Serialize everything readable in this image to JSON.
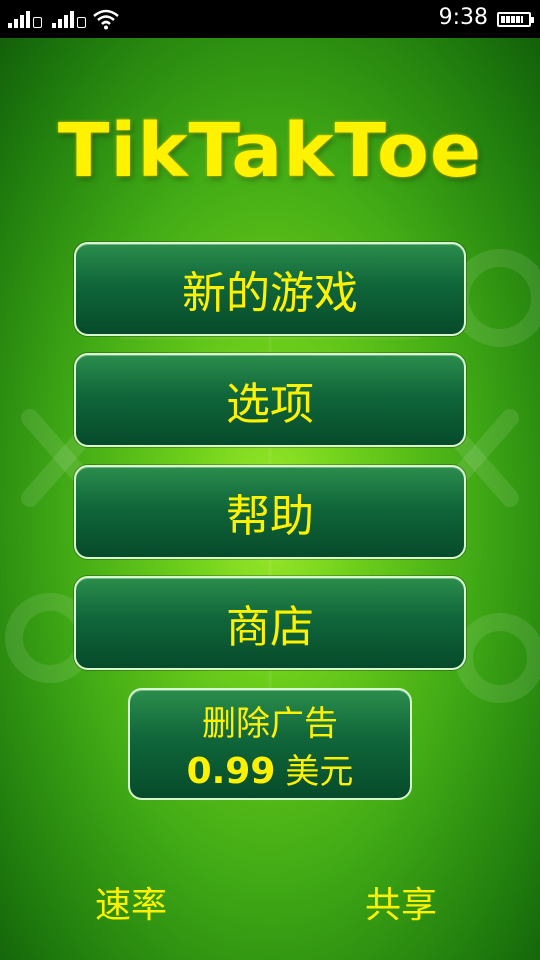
{
  "status_bar": {
    "time": "9:38",
    "sim1_label": "1",
    "sim2_label": "2",
    "icons": [
      "signal-icon",
      "signal-icon",
      "wifi-icon",
      "battery-icon"
    ]
  },
  "game": {
    "logo": "TikTakToe",
    "menu": {
      "new_game": "新的游戏",
      "options": "选项",
      "help": "帮助",
      "shop": "商店"
    },
    "remove_ads": {
      "title": "删除广告",
      "price": "0.99",
      "currency": "美元"
    },
    "footer": {
      "rate": "速率",
      "share": "共享"
    }
  },
  "colors": {
    "accent_text": "#fff200",
    "button_dark": "#064b2b",
    "background_green": "#3fa815"
  }
}
